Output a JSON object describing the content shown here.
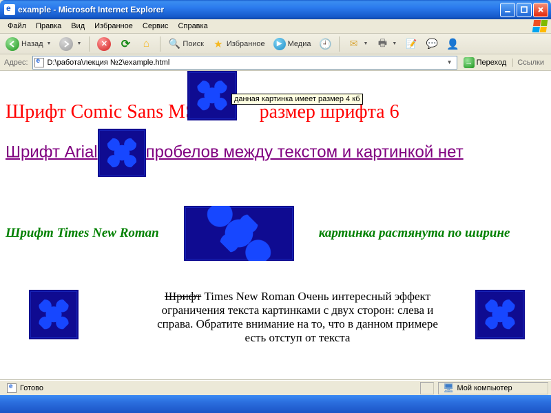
{
  "window": {
    "title": "example - Microsoft Internet Explorer"
  },
  "menu": {
    "file": "Файл",
    "edit": "Правка",
    "view": "Вид",
    "favorites": "Избранное",
    "tools": "Сервис",
    "help": "Справка"
  },
  "toolbar": {
    "back": "Назад",
    "search": "Поиск",
    "favorites": "Избранное",
    "media": "Медиа"
  },
  "address": {
    "label": "Адрес:",
    "path": "D:\\работа\\лекция №2\\example.html",
    "go": "Переход",
    "links": "Ссылки"
  },
  "content": {
    "tooltip": "данная картинка имеет размер 4 кб",
    "comic_a": "Шрифт Comic Sans MS",
    "comic_b": "размер шрифта 6",
    "arial_a": "Шрифт Arial",
    "arial_b": "пробелов между текстом и картинкой нет",
    "tnr_green_a": "Шрифт Times New Roman",
    "tnr_green_b": "картинка растянута по ширине",
    "tnr_strike": "Шрифт",
    "tnr_block": " Times New Roman Очень интересный эффект ограничения текста картинками с двух сторон: слева и справа. Обратите внимание на то, что в данном примере есть отступ от текста"
  },
  "status": {
    "done": "Готово",
    "zone": "Мой компьютер"
  }
}
